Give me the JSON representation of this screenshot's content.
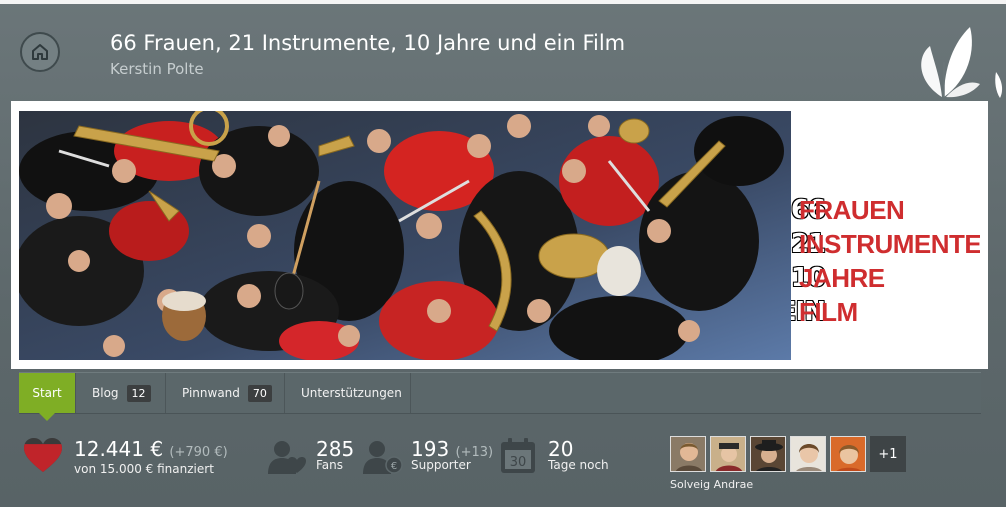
{
  "header": {
    "title": "66 Frauen, 21 Instrumente, 10 Jahre und ein Film",
    "author": "Kerstin Polte"
  },
  "banner": {
    "numbers": [
      "66",
      "21",
      "10",
      "EIN"
    ],
    "words": [
      "FRAUEN",
      "INSTRUMENTE",
      "JAHRE",
      "FILM"
    ]
  },
  "tabs": [
    {
      "label": "Start"
    },
    {
      "label": "Blog",
      "count": "12"
    },
    {
      "label": "Pinnwand",
      "count": "70"
    },
    {
      "label": "Unterstützungen"
    }
  ],
  "stats": {
    "funding": {
      "amount": "12.441 €",
      "delta": "(+790 €)",
      "goal": "von 15.000 € finanziert",
      "progress_fraction": 0.83
    },
    "fans": {
      "value": "285",
      "label": "Fans"
    },
    "supporters": {
      "value": "193",
      "delta": "(+13)",
      "label": "Supporter"
    },
    "days": {
      "value": "20",
      "label": "Tage noch",
      "calendar_day": "30"
    }
  },
  "supporters_strip": {
    "more": "+1",
    "first_name": "Solveig Andrae"
  },
  "colors": {
    "accent_green": "#7fae25",
    "banner_red": "#cf2d2f",
    "heart_red": "#c0242a"
  }
}
